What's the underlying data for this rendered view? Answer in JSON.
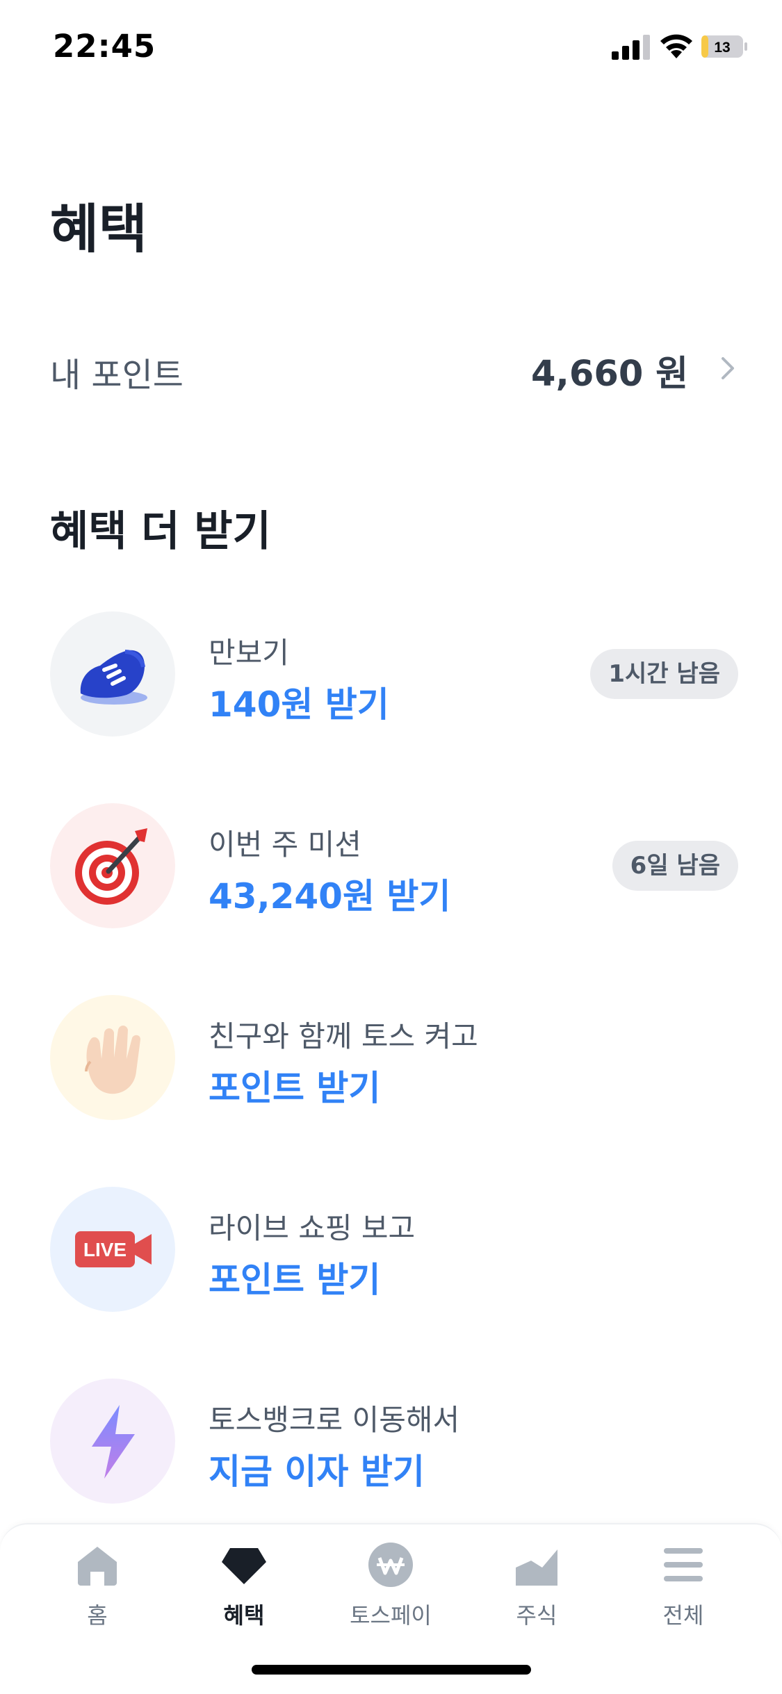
{
  "status_bar": {
    "time": "22:45",
    "battery_level": "13"
  },
  "page": {
    "title": "혜택"
  },
  "points": {
    "label": "내 포인트",
    "value": "4,660 원"
  },
  "section": {
    "title": "혜택 더 받기"
  },
  "items": [
    {
      "subtitle": "만보기",
      "action": "140원 받기",
      "badge": "1시간 남음",
      "icon": "shoe-icon",
      "bg": "#f2f4f6"
    },
    {
      "subtitle": "이번 주 미션",
      "action": "43,240원 받기",
      "badge": "6일 남음",
      "icon": "target-icon",
      "bg": "#fdeeee"
    },
    {
      "subtitle": "친구와 함께 토스 켜고",
      "action": "포인트 받기",
      "icon": "waving-hand-icon",
      "bg": "#fff8e6"
    },
    {
      "subtitle": "라이브 쇼핑 보고",
      "action": "포인트 받기",
      "icon": "live-camera-icon",
      "bg": "#eaf2fe",
      "icon_text": "LIVE"
    },
    {
      "subtitle": "토스뱅크로 이동해서",
      "action": "지금 이자 받기",
      "icon": "lightning-icon",
      "bg": "#f5eefb"
    }
  ],
  "tabs": [
    {
      "label": "홈",
      "icon": "home-icon",
      "active": false
    },
    {
      "label": "혜택",
      "icon": "gem-icon",
      "active": true
    },
    {
      "label": "토스페이",
      "icon": "won-coin-icon",
      "active": false
    },
    {
      "label": "주식",
      "icon": "stock-chart-icon",
      "active": false
    },
    {
      "label": "전체",
      "icon": "menu-icon",
      "active": false
    }
  ],
  "colors": {
    "accent": "#3182f6",
    "text_primary": "#191f28",
    "text_secondary": "#4e5968",
    "battery_low": "#f7c948"
  }
}
